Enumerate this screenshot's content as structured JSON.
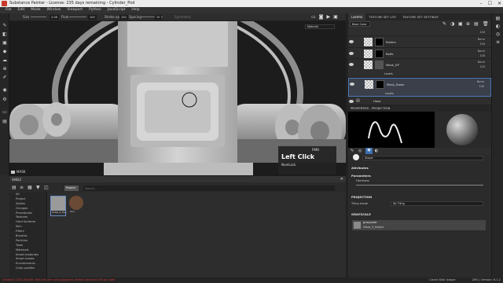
{
  "window": {
    "title": "Substance Painter - License: 235 days remaining - Cylinder_Pod"
  },
  "menu": [
    "File",
    "Edit",
    "Mode",
    "Window",
    "Viewport",
    "Python",
    "JavaScript",
    "Help"
  ],
  "tool_options": {
    "size_label": "Size",
    "size_value": "2.06",
    "flow_label": "Flow",
    "flow_value": "100",
    "stroke_opacity_label": "Stroke opacity",
    "stroke_opacity_value": "100",
    "spacing_label": "Spacing",
    "spacing_value": "20",
    "symmetry_label": "Symmetry"
  },
  "viewport": {
    "material_dropdown": "Material",
    "mask_label": "MASK",
    "shortcut_hint": {
      "key": "Left Click",
      "action": "RMB",
      "sub": "NumLock"
    }
  },
  "panel_tabs": [
    "LAYERS",
    "TEXTURE SET LIST",
    "TEXTURE SET SETTINGS"
  ],
  "layers": {
    "blend_mode": "Base Color",
    "items": [
      {
        "name": "",
        "blend": "Norm",
        "opacity": "100"
      },
      {
        "name": "Rollers",
        "blend": "Norm",
        "opacity": "100"
      },
      {
        "name": "Bolts",
        "blend": "Norm",
        "opacity": "100"
      },
      {
        "name": "Mask_UP",
        "blend": "Norm",
        "opacity": "100",
        "sub": "Levels"
      },
      {
        "name": "Mask_Down",
        "blend": "Norm",
        "opacity": "100",
        "sub": "Levels"
      },
      {
        "name": "Hose",
        "blend": "Norm",
        "opacity": ""
      }
    ]
  },
  "properties": {
    "title": "PROPERTIES - PROJECTION",
    "shape_label": "Shape",
    "attributes_label": "Attributes",
    "parameters_label": "Parameters",
    "hardness_label": "Hardness",
    "projection_label": "PROJECTION",
    "tiling_mode_label": "Tiling mode",
    "tiling_mode_value": "No Tiling",
    "grayscale_label": "GRAYSCALE",
    "grayscale_name": "grayscale",
    "grayscale_file": "Vidas_3_Height"
  },
  "shelf": {
    "title": "SHELF",
    "search_placeholder": "Search...",
    "filter_tag": "Project",
    "categories": [
      "All",
      "Project",
      "Alphas",
      "Grunges",
      "Procedurals",
      "Textures",
      "Hard Surfaces",
      "Skin",
      "Filters",
      "Brushes",
      "Particles",
      "Tools",
      "Materials",
      "Smart materials",
      "Smart masks",
      "Environments",
      "Color profiles"
    ],
    "items": [
      {
        "name": "Vidas_3_He..."
      },
      {
        "name": "Soil"
      }
    ]
  },
  "status": {
    "error": "[Shader] CSSG-Nvidia: textures are not supported; default textures will be used",
    "cache": "Cache Disk Usage:",
    "gpu": "28% | Version: 6.1.2"
  }
}
